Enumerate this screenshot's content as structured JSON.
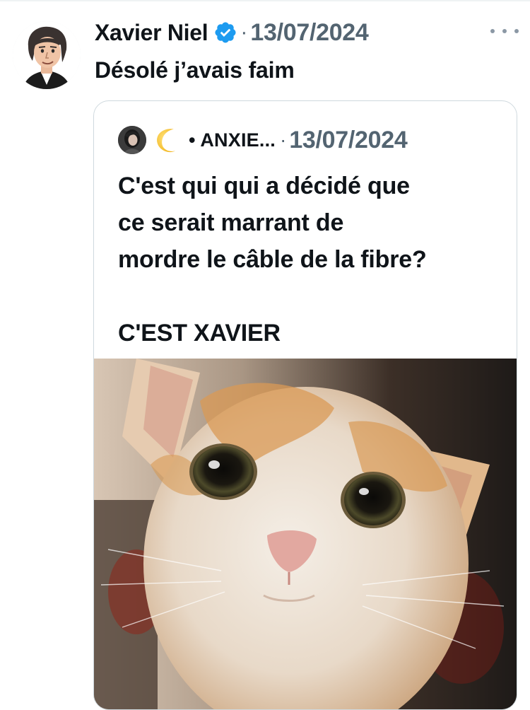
{
  "tweet": {
    "author_name": "Xavier Niel",
    "verified_icon": "verified-badge-icon",
    "separator": "·",
    "date": "13/07/2024",
    "more_icon": "more-horizontal-icon",
    "text": "Désolé j’avais faim"
  },
  "quote": {
    "emoji": "🌙",
    "author_name": "• ANXIE...",
    "separator": "·",
    "date": "13/07/2024",
    "lines": [
      "C'est qui qui a décidé que",
      "ce serait marrant de",
      "mordre le câble de la fibre?",
      "",
      "C'EST XAVIER"
    ],
    "image_subject": "photo of a startled orange and white kitten"
  },
  "colors": {
    "text": "#0f1419",
    "secondary_text": "#536471",
    "verified_blue": "#1d9bf0",
    "border": "#cfd9de"
  }
}
